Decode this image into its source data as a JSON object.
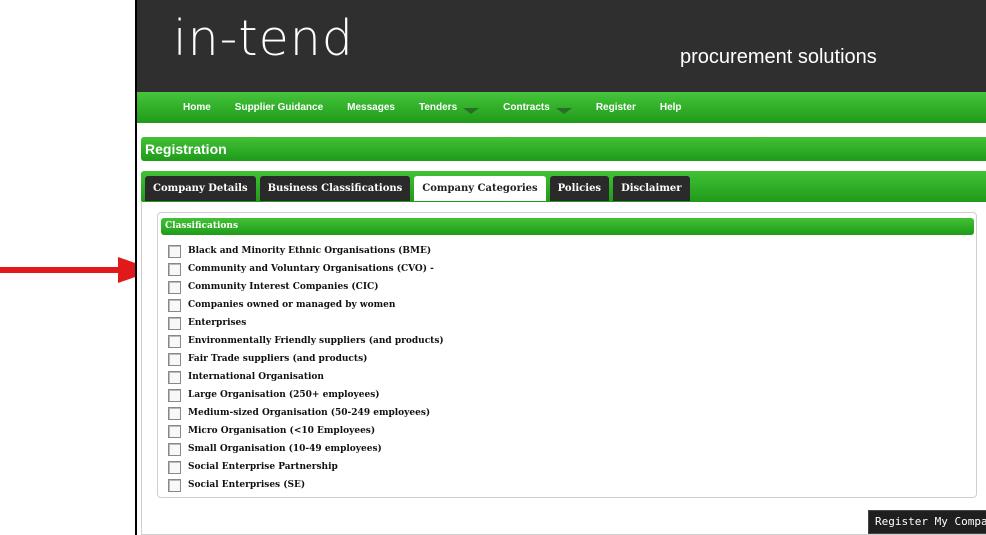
{
  "header": {
    "logo_text": "in-tend",
    "tagline": "procurement solutions"
  },
  "nav": {
    "items": [
      {
        "label": "Home",
        "has_dropdown": false
      },
      {
        "label": "Supplier Guidance",
        "has_dropdown": false
      },
      {
        "label": "Messages",
        "has_dropdown": false
      },
      {
        "label": "Tenders",
        "has_dropdown": true
      },
      {
        "label": "Contracts",
        "has_dropdown": true
      },
      {
        "label": "Register",
        "has_dropdown": false
      },
      {
        "label": "Help",
        "has_dropdown": false
      }
    ]
  },
  "page": {
    "section_title": "Registration"
  },
  "tabs": [
    {
      "label": "Company Details",
      "active": false
    },
    {
      "label": "Business Classifications",
      "active": false
    },
    {
      "label": "Company Categories",
      "active": true
    },
    {
      "label": "Policies",
      "active": false
    },
    {
      "label": "Disclaimer",
      "active": false
    }
  ],
  "classifications": {
    "title": "Classifications",
    "items": [
      {
        "label": "Black and Minority Ethnic Organisations (BME)",
        "checked": false
      },
      {
        "label": "Community and Voluntary Organisations (CVO) -",
        "checked": false
      },
      {
        "label": "Community Interest Companies (CIC)",
        "checked": false
      },
      {
        "label": "Companies owned or managed by women",
        "checked": false
      },
      {
        "label": "Enterprises",
        "checked": false
      },
      {
        "label": "Environmentally Friendly suppliers (and products)",
        "checked": false
      },
      {
        "label": "Fair Trade suppliers (and products)",
        "checked": false
      },
      {
        "label": "International Organisation",
        "checked": false
      },
      {
        "label": "Large Organisation (250+ employees)",
        "checked": false
      },
      {
        "label": "Medium-sized Organisation (50-249 employees)",
        "checked": false
      },
      {
        "label": "Micro Organisation (<10 Employees)",
        "checked": false
      },
      {
        "label": "Small Organisation (10-49 employees)",
        "checked": false
      },
      {
        "label": "Social Enterprise Partnership",
        "checked": false
      },
      {
        "label": "Social Enterprises (SE)",
        "checked": false
      }
    ]
  },
  "actions": {
    "register_label": "Register My Company"
  },
  "colors": {
    "brand_green": "#2fae29",
    "header_dark": "#2f2f2f",
    "annotation_arrow": "#e0191b"
  }
}
